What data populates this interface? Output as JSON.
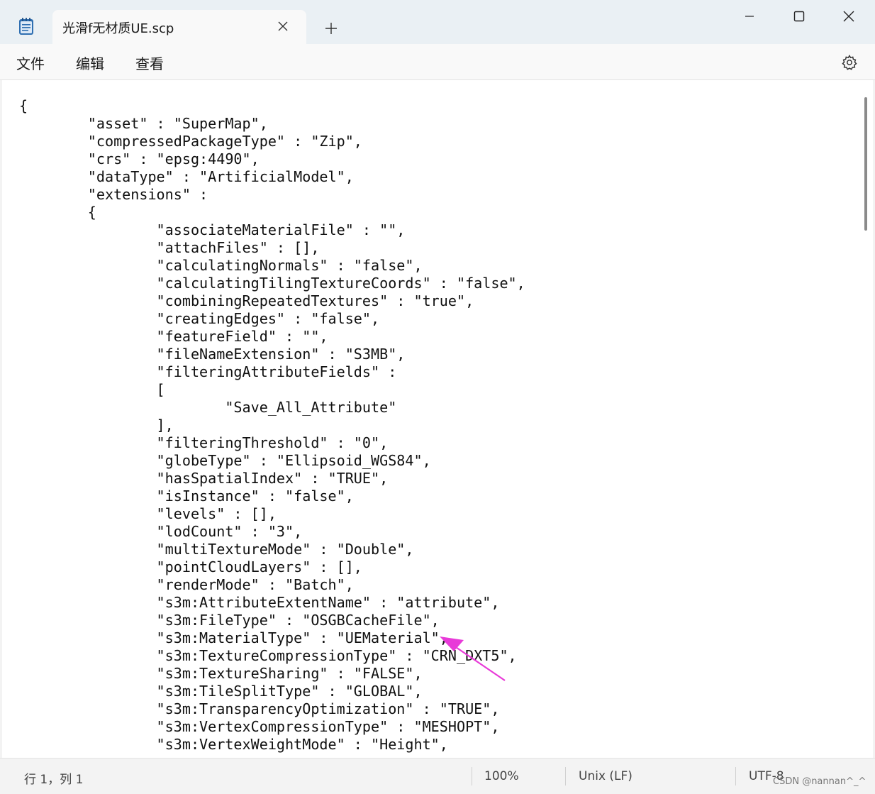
{
  "tab": {
    "title": "光滑f无材质UE.scp"
  },
  "icons": {
    "app": "notepad-icon",
    "tab_close": "close-icon",
    "new_tab": "plus-icon",
    "minimize": "minimize-icon",
    "maximize": "maximize-icon",
    "close": "close-icon",
    "settings": "gear-icon"
  },
  "menu": {
    "file": "文件",
    "edit": "编辑",
    "view": "查看"
  },
  "editor": {
    "lines": [
      "{",
      "        \"asset\" : \"SuperMap\",",
      "        \"compressedPackageType\" : \"Zip\",",
      "        \"crs\" : \"epsg:4490\",",
      "        \"dataType\" : \"ArtificialModel\",",
      "        \"extensions\" :",
      "        {",
      "                \"associateMaterialFile\" : \"\",",
      "                \"attachFiles\" : [],",
      "                \"calculatingNormals\" : \"false\",",
      "                \"calculatingTilingTextureCoords\" : \"false\",",
      "                \"combiningRepeatedTextures\" : \"true\",",
      "                \"creatingEdges\" : \"false\",",
      "                \"featureField\" : \"\",",
      "                \"fileNameExtension\" : \"S3MB\",",
      "                \"filteringAttributeFields\" :",
      "                [",
      "                        \"Save_All_Attribute\"",
      "                ],",
      "                \"filteringThreshold\" : \"0\",",
      "                \"globeType\" : \"Ellipsoid_WGS84\",",
      "                \"hasSpatialIndex\" : \"TRUE\",",
      "                \"isInstance\" : \"false\",",
      "                \"levels\" : [],",
      "                \"lodCount\" : \"3\",",
      "                \"multiTextureMode\" : \"Double\",",
      "                \"pointCloudLayers\" : [],",
      "                \"renderMode\" : \"Batch\",",
      "                \"s3m:AttributeExtentName\" : \"attribute\",",
      "                \"s3m:FileType\" : \"OSGBCacheFile\",",
      "                \"s3m:MaterialType\" : \"UEMaterial\",",
      "                \"s3m:TextureCompressionType\" : \"CRN_DXT5\",",
      "                \"s3m:TextureSharing\" : \"FALSE\",",
      "                \"s3m:TileSplitType\" : \"GLOBAL\",",
      "                \"s3m:TransparencyOptimization\" : \"TRUE\",",
      "                \"s3m:VertexCompressionType\" : \"MESHOPT\",",
      "                \"s3m:VertexWeightMode\" : \"Height\","
    ]
  },
  "annotation": {
    "arrow_color": "#e83ad8"
  },
  "status": {
    "position": "行 1，列 1",
    "zoom": "100%",
    "line_ending": "Unix (LF)",
    "encoding": "UTF-8"
  },
  "watermark": "CSDN @nannan^_^"
}
